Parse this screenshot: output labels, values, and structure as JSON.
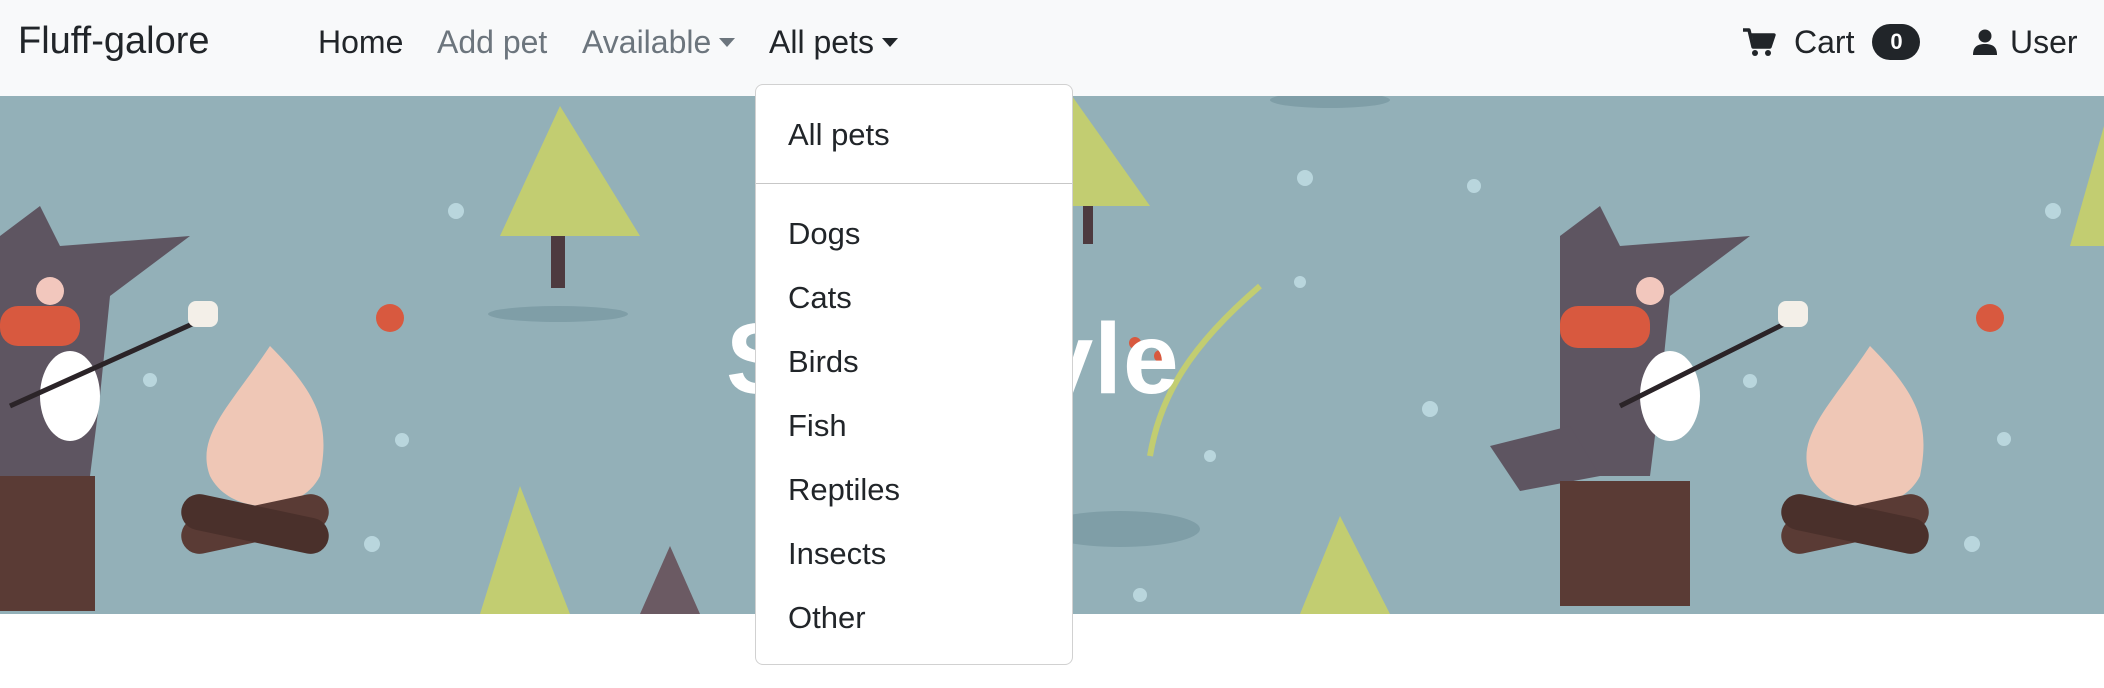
{
  "brand": "Fluff-galore",
  "nav": {
    "home": "Home",
    "add_pet": "Add pet",
    "available": "Available",
    "all_pets": "All pets"
  },
  "cart": {
    "label": "Cart",
    "count": "0"
  },
  "user": {
    "label": "User"
  },
  "hero": {
    "title": "Sun style"
  },
  "dropdown": {
    "header_item": "All pets",
    "items": [
      "Dogs",
      "Cats",
      "Birds",
      "Fish",
      "Reptiles",
      "Insects",
      "Other"
    ]
  },
  "colors": {
    "navbar_bg": "#f8f9fa",
    "hero_bg": "#93b0b8",
    "text": "#212529",
    "muted_link": "#6c757d"
  }
}
